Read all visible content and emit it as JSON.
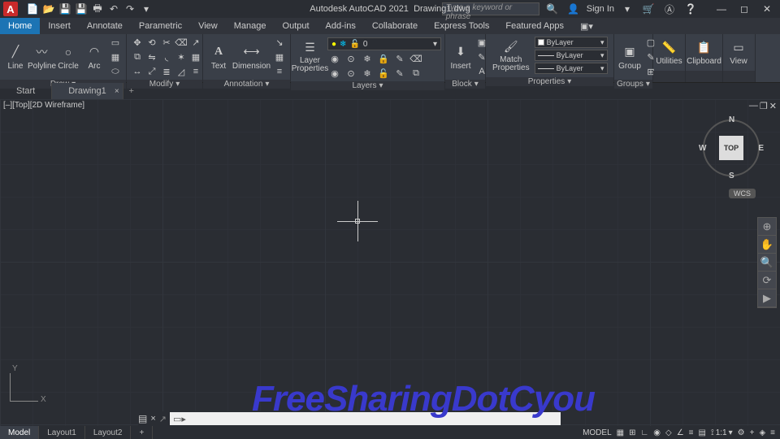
{
  "qat": {
    "app_title": "Autodesk AutoCAD 2021",
    "doc": "Drawing1.dwg",
    "search_placeholder": "Type a keyword or phrase",
    "signin": "Sign In"
  },
  "menubar": [
    "Home",
    "Insert",
    "Annotate",
    "Parametric",
    "View",
    "Manage",
    "Output",
    "Add-ins",
    "Collaborate",
    "Express Tools",
    "Featured Apps"
  ],
  "ribbon": {
    "draw": {
      "label": "Draw",
      "btns": [
        "Line",
        "Polyline",
        "Circle",
        "Arc"
      ]
    },
    "modify": {
      "label": "Modify"
    },
    "annotation": {
      "label": "Annotation",
      "btns": [
        "Text",
        "Dimension"
      ]
    },
    "layers": {
      "label": "Layers",
      "btn": "Layer\nProperties",
      "current": "0"
    },
    "block": {
      "label": "Block",
      "btn": "Insert"
    },
    "properties": {
      "label": "Properties",
      "btn": "Match\nProperties",
      "vals": [
        "ByLayer",
        "ByLayer",
        "ByLayer"
      ]
    },
    "groups": {
      "label": "Groups",
      "btn": "Group"
    },
    "utilities": {
      "label": "Utilities"
    },
    "clipboard": {
      "label": "Clipboard"
    },
    "view": {
      "label": "View"
    }
  },
  "filetabs": {
    "start": "Start",
    "active": "Drawing1"
  },
  "viewport": {
    "label": "[–][Top][2D Wireframe]",
    "cube": "TOP",
    "wcs": "WCS",
    "n": "N",
    "s": "S",
    "e": "E",
    "w": "W",
    "y": "Y",
    "x": "X"
  },
  "layouts": [
    "Model",
    "Layout1",
    "Layout2"
  ],
  "status": {
    "model": "MODEL",
    "scale": "1:1"
  },
  "watermark": "FreeSharingDotCyou"
}
